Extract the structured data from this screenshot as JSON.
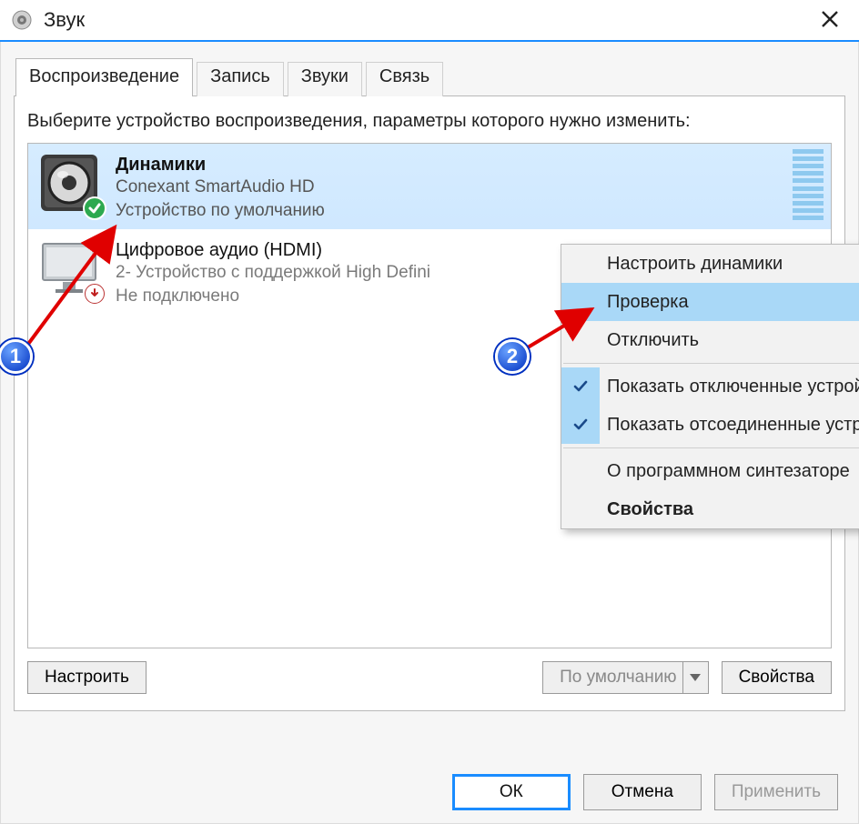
{
  "window": {
    "title": "Звук"
  },
  "tabs": [
    "Воспроизведение",
    "Запись",
    "Звуки",
    "Связь"
  ],
  "active_tab": 0,
  "instruction": "Выберите устройство воспроизведения, параметры которого нужно изменить:",
  "devices": [
    {
      "name": "Динамики",
      "driver": "Conexant SmartAudio HD",
      "status": "Устройство по умолчанию",
      "default": true,
      "connected": true,
      "selected": true
    },
    {
      "name": "Цифровое аудио (HDMI)",
      "driver": "2- Устройство с поддержкой High Defini",
      "status": "Не подключено",
      "default": false,
      "connected": false,
      "selected": false
    }
  ],
  "panel_buttons": {
    "configure": "Настроить",
    "set_default": "По умолчанию",
    "properties": "Свойства"
  },
  "dialog_buttons": {
    "ok": "ОК",
    "cancel": "Отмена",
    "apply": "Применить"
  },
  "context_menu": {
    "groups": [
      [
        {
          "label": "Настроить динамики",
          "checked": false
        },
        {
          "label": "Проверка",
          "checked": false,
          "hover": true
        },
        {
          "label": "Отключить",
          "checked": false
        }
      ],
      [
        {
          "label": "Показать отключенные устройства",
          "checked": true
        },
        {
          "label": "Показать отсоединенные устройства",
          "checked": true
        }
      ],
      [
        {
          "label": "О программном синтезаторе",
          "checked": false
        },
        {
          "label": "Свойства",
          "checked": false,
          "bold": true
        }
      ]
    ]
  },
  "markers": {
    "one": "1",
    "two": "2"
  }
}
